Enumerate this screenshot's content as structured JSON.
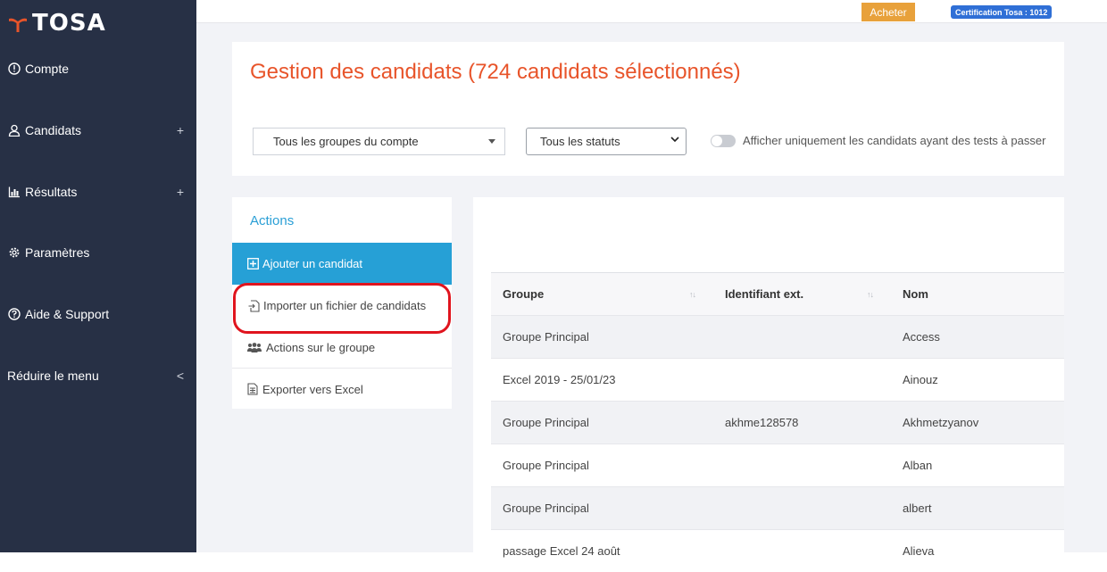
{
  "brand": {
    "name": "TOSA",
    "colors": {
      "accent": "#e8542a",
      "sidebar": "#273045",
      "primary": "#26a0d6",
      "buy": "#e8a13b",
      "cert": "#2f6fd6",
      "highlight": "#e0141e"
    }
  },
  "sidebar": {
    "items": [
      {
        "label": "Compte",
        "icon": "info-circle-icon",
        "expand": ""
      },
      {
        "label": "Candidats",
        "icon": "user-icon",
        "expand": "+"
      },
      {
        "label": "Résultats",
        "icon": "bar-chart-icon",
        "expand": "+"
      },
      {
        "label": "Paramètres",
        "icon": "gear-icon",
        "expand": ""
      },
      {
        "label": "Aide & Support",
        "icon": "help-circle-icon",
        "expand": ""
      },
      {
        "label": "Réduire le menu",
        "icon": "",
        "expand": "<"
      }
    ]
  },
  "topbar": {
    "buy_label": "Acheter",
    "certification_badge": "Certification Tosa : 1012"
  },
  "page": {
    "title": "Gestion des candidats (724 candidats sélectionnés)",
    "filters": {
      "groups_value": "Tous les groupes du compte",
      "status_value": "Tous les statuts",
      "toggle_label": "Afficher uniquement les candidats ayant des tests à passer",
      "toggle_on": false
    }
  },
  "actions": {
    "title": "Actions",
    "items": [
      {
        "label": "Ajouter un candidat",
        "icon": "plus-square-icon"
      },
      {
        "label": "Importer un fichier de candidats",
        "icon": "file-import-icon"
      },
      {
        "label": "Actions sur le groupe",
        "icon": "users-group-icon"
      },
      {
        "label": "Exporter vers Excel",
        "icon": "spreadsheet-file-icon"
      }
    ]
  },
  "table": {
    "columns": [
      "Groupe",
      "Identifiant ext.",
      "Nom"
    ],
    "sort_icon": "↑↓",
    "rows": [
      [
        "Groupe Principal",
        "",
        "Access"
      ],
      [
        "Excel 2019 - 25/01/23",
        "",
        "Ainouz"
      ],
      [
        "Groupe Principal",
        "akhme128578",
        "Akhmetzyanov"
      ],
      [
        "Groupe Principal",
        "",
        "Alban"
      ],
      [
        "Groupe Principal",
        "",
        "albert"
      ],
      [
        "passage Excel 24 août",
        "",
        "Alieva"
      ]
    ]
  }
}
